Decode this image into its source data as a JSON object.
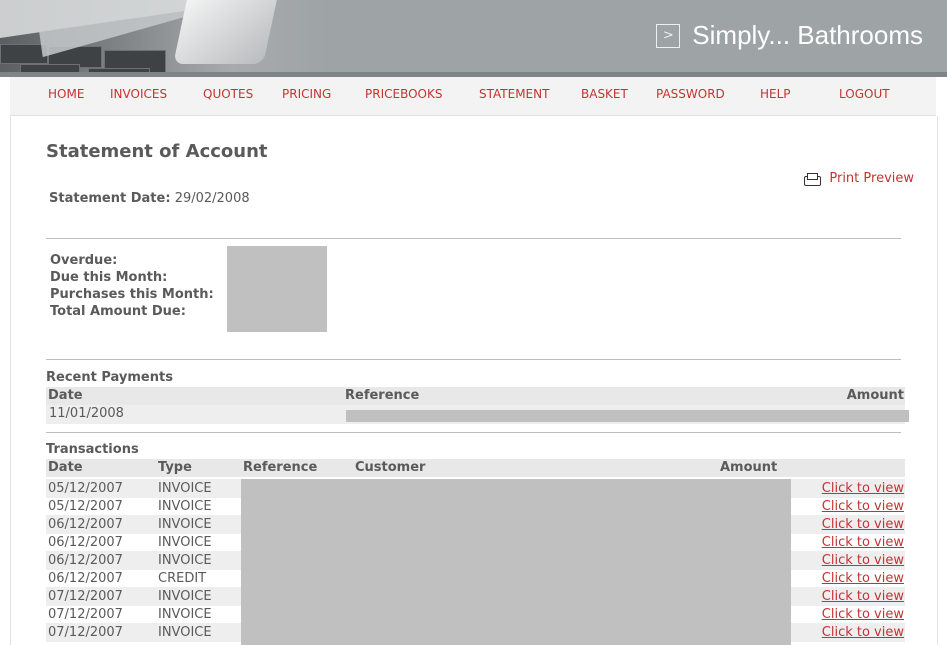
{
  "brand": {
    "name": "Simply... Bathrooms",
    "icon": "chevron-right-icon"
  },
  "nav": [
    "HOME",
    "INVOICES",
    "QUOTES",
    "PRICING",
    "PRICEBOOKS",
    "STATEMENT",
    "BASKET",
    "PASSWORD",
    "HELP",
    "LOGOUT"
  ],
  "page": {
    "title": "Statement of Account",
    "statement_date_label": "Statement Date:",
    "statement_date": "29/02/2008",
    "print_preview": "Print Preview"
  },
  "summary": [
    "Overdue:",
    "Due this Month:",
    "Purchases this Month:",
    "Total Amount Due:"
  ],
  "recent_payments": {
    "title": "Recent Payments",
    "headers": {
      "date": "Date",
      "reference": "Reference",
      "amount": "Amount"
    },
    "rows": [
      {
        "date": "11/01/2008"
      }
    ]
  },
  "transactions": {
    "title": "Transactions",
    "headers": {
      "date": "Date",
      "type": "Type",
      "reference": "Reference",
      "customer": "Customer",
      "amount": "Amount"
    },
    "rows": [
      {
        "date": "05/12/2007",
        "type": "INVOICE",
        "action": "Click to view"
      },
      {
        "date": "05/12/2007",
        "type": "INVOICE",
        "action": "Click to view"
      },
      {
        "date": "06/12/2007",
        "type": "INVOICE",
        "action": "Click to view"
      },
      {
        "date": "06/12/2007",
        "type": "INVOICE",
        "action": "Click to view"
      },
      {
        "date": "06/12/2007",
        "type": "INVOICE",
        "action": "Click to view"
      },
      {
        "date": "06/12/2007",
        "type": "CREDIT",
        "action": "Click to view"
      },
      {
        "date": "07/12/2007",
        "type": "INVOICE",
        "action": "Click to view"
      },
      {
        "date": "07/12/2007",
        "type": "INVOICE",
        "action": "Click to view"
      },
      {
        "date": "07/12/2007",
        "type": "INVOICE",
        "action": "Click to view"
      }
    ]
  },
  "colors": {
    "link": "#c43333",
    "text": "#5a5a5a",
    "banner": "#9ea3a5",
    "alt_row": "#eeeeee",
    "redaction": "#c0c0c0"
  }
}
